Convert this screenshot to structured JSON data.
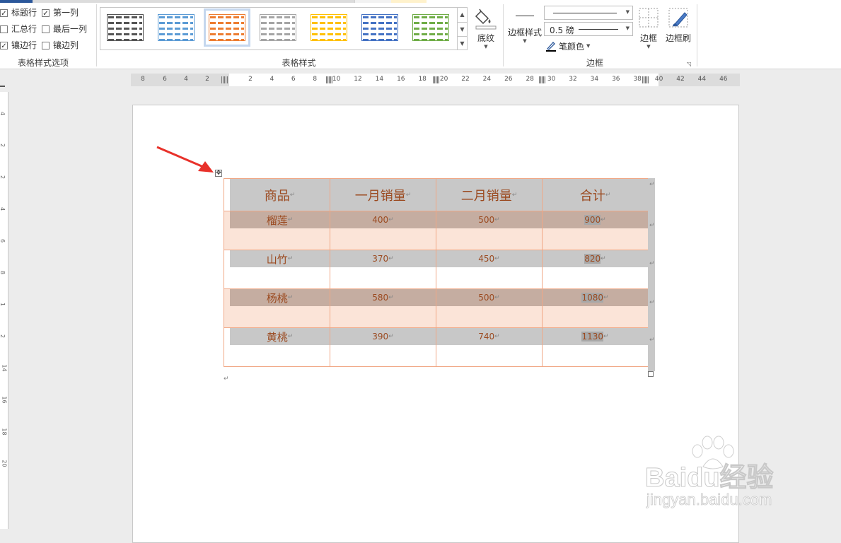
{
  "table_style_options": {
    "group_label": "表格样式选项",
    "options": [
      {
        "label": "标题行",
        "checked": true
      },
      {
        "label": "第一列",
        "checked": true
      },
      {
        "label": "汇总行",
        "checked": false
      },
      {
        "label": "最后一列",
        "checked": false
      },
      {
        "label": "镶边行",
        "checked": true
      },
      {
        "label": "镶边列",
        "checked": false
      }
    ],
    "check_glyph": "✓"
  },
  "table_styles": {
    "group_label": "表格样式",
    "swatches": [
      {
        "color": "#555555"
      },
      {
        "color": "#5b9bd5"
      },
      {
        "color": "#ed7d31",
        "selected": true
      },
      {
        "color": "#a5a5a5"
      },
      {
        "color": "#ffc000"
      },
      {
        "color": "#4472c4"
      },
      {
        "color": "#70ad47"
      }
    ],
    "shading_label": "底纹"
  },
  "borders": {
    "group_label": "边框",
    "border_style_label": "边框样式",
    "line_weight": "0.5 磅",
    "pen_color_label": "笔颜色",
    "borders_label": "边框",
    "border_painter_label": "边框刷"
  },
  "ruler": {
    "left_ticks": [
      "8",
      "6",
      "4",
      "2"
    ],
    "ticks": [
      "2",
      "4",
      "6",
      "8",
      "10",
      "12",
      "14",
      "16",
      "18",
      "20",
      "22",
      "24",
      "26",
      "28",
      "30",
      "32",
      "34",
      "36",
      "38",
      "40",
      "42",
      "44",
      "46"
    ]
  },
  "vertical_ruler": [
    "4",
    "2",
    "2",
    "4",
    "6",
    "8",
    "1",
    "2",
    "14",
    "16",
    "18",
    "20"
  ],
  "table": {
    "headers": [
      "商品",
      "一月销量",
      "二月销量",
      "合计"
    ],
    "rows": [
      {
        "item": "榴莲",
        "jan": "400",
        "feb": "500",
        "total": "900"
      },
      {
        "item": "山竹",
        "jan": "370",
        "feb": "450",
        "total": "820"
      },
      {
        "item": "杨桃",
        "jan": "580",
        "feb": "500",
        "total": "1080"
      },
      {
        "item": "黄桃",
        "jan": "390",
        "feb": "740",
        "total": "1130"
      }
    ],
    "para_mark": "↵"
  },
  "watermark": {
    "brand": "Baidu经验",
    "url": "jingyan.baidu.com"
  },
  "colors": {
    "accent": "#ed7d31",
    "header_fill": "#c8c8c8",
    "band_fill": "#fbe4d8",
    "text": "#9b4a20",
    "arrow": "#e8312a"
  }
}
